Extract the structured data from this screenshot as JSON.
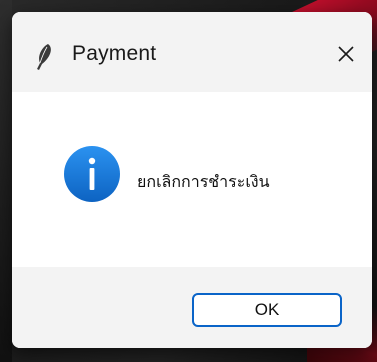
{
  "dialog": {
    "title": "Payment",
    "title_icon": "feather-icon",
    "close_icon": "close-icon",
    "message": "ยกเลิกการชำระเงิน",
    "message_icon": "info-icon",
    "ok_label": "OK"
  },
  "colors": {
    "accent": "#0a64c8",
    "info_icon": "#1a7fe0",
    "titlebar_bg": "#f3f3f3",
    "content_bg": "#ffffff",
    "text": "#111111"
  }
}
